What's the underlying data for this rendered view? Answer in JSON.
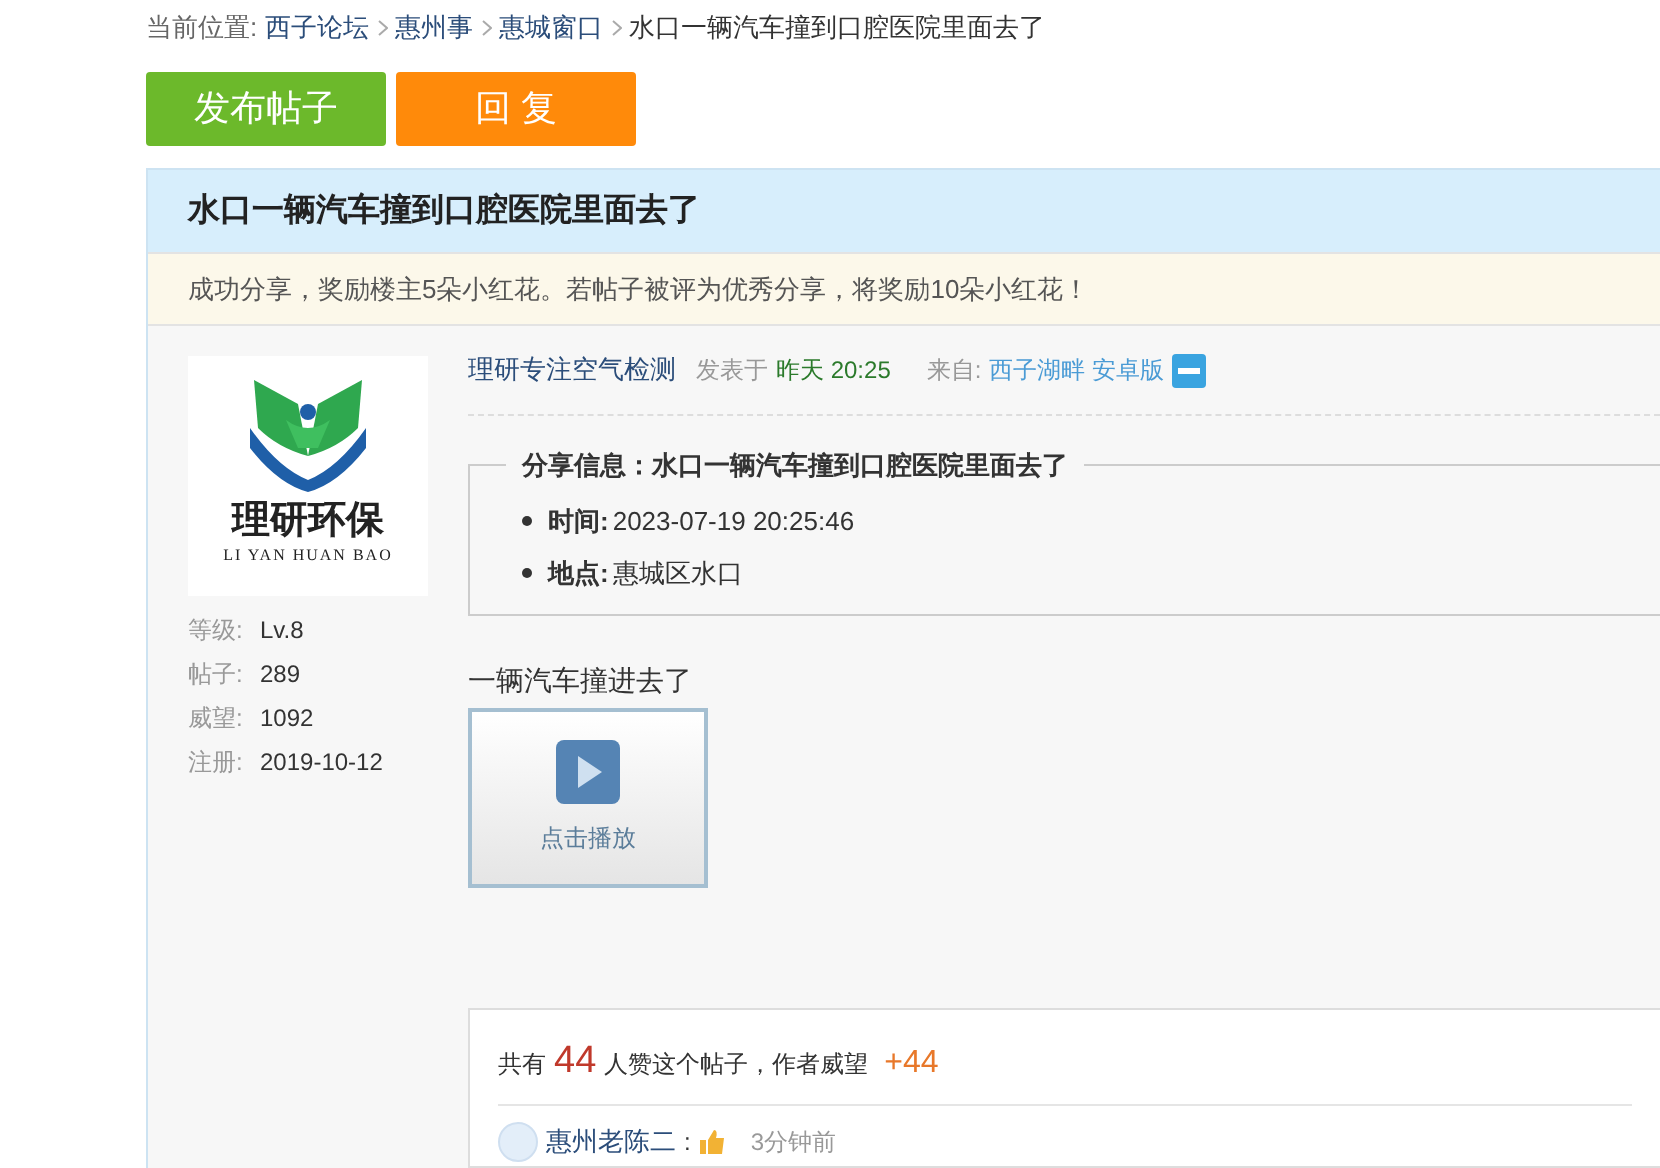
{
  "breadcrumb": {
    "label": "当前位置:",
    "items": [
      "西子论坛",
      "惠州事",
      "惠城窗口",
      "水口一辆汽车撞到口腔医院里面去了"
    ]
  },
  "actions": [
    {
      "label": "发布帖子",
      "kind": "post"
    },
    {
      "label": "回 复",
      "kind": "reply"
    }
  ],
  "thread": {
    "title": "水口一辆汽车撞到口腔医院里面去了",
    "notice": "成功分享，奖励楼主5朵小红花。若帖子被评为优秀分享，将奖励10朵小红花！"
  },
  "author": {
    "logo_text": "理研环保",
    "logo_subtext": "LI YAN HUAN BAO",
    "stats": [
      {
        "label": "等级:",
        "value": "Lv.8"
      },
      {
        "label": "帖子:",
        "value": "289"
      },
      {
        "label": "威望:",
        "value": "1092"
      },
      {
        "label": "注册:",
        "value": "2019-10-12"
      }
    ]
  },
  "post": {
    "author": "理研专注空气检测",
    "posted_label": "发表于",
    "posted_time": "昨天 20:25",
    "source_label": "来自:",
    "source": "西子湖畔 安卓版",
    "share": {
      "legend": "分享信息：水口一辆汽车撞到口腔医院里面去了",
      "items": [
        {
          "label": "时间:",
          "value": "2023-07-19 20:25:46"
        },
        {
          "label": "地点:",
          "value": "惠城区水口"
        }
      ]
    },
    "body": "一辆汽车撞进去了",
    "video": {
      "label": "点击播放"
    }
  },
  "likes": {
    "prefix": "共有",
    "count": "44",
    "middle": "人赞这个帖子，作者威望",
    "bonus": "+44",
    "entries": [
      {
        "user": "惠州老陈二",
        "separator": ":",
        "time": "3分钟前"
      }
    ]
  }
}
